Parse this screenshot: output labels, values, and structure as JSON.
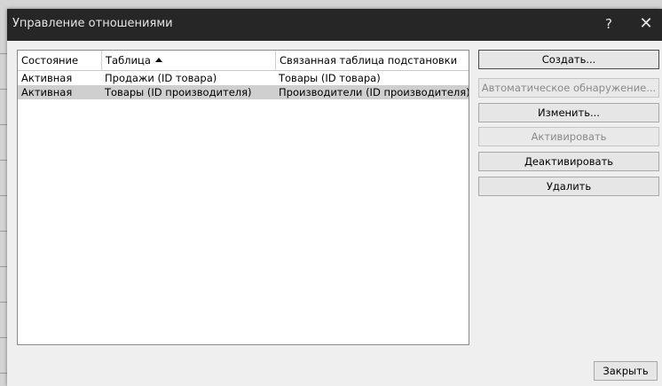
{
  "dialog": {
    "title": "Управление отношениями",
    "help_label": "?",
    "close_label": "✕"
  },
  "table": {
    "columns": [
      "Состояние",
      "Таблица",
      "Связанная таблица подстановки"
    ],
    "sort_column": "Таблица",
    "sort_direction": "ascending",
    "rows": [
      {
        "state": "Активная",
        "table": "Продажи (ID товара)",
        "lookup": "Товары (ID товара)",
        "selected": false
      },
      {
        "state": "Активная",
        "table": "Товары (ID производителя)",
        "lookup": "Производители (ID производителя)",
        "selected": true
      }
    ]
  },
  "buttons": {
    "create": {
      "label": "Создать...",
      "enabled": true
    },
    "autodetect": {
      "label": "Автоматическое обнаружение...",
      "enabled": false
    },
    "edit": {
      "label": "Изменить...",
      "enabled": true
    },
    "activate": {
      "label": "Активировать",
      "enabled": false
    },
    "deactivate": {
      "label": "Деактивировать",
      "enabled": true
    },
    "delete": {
      "label": "Удалить",
      "enabled": true
    }
  },
  "footer": {
    "close_label": "Закрыть"
  }
}
